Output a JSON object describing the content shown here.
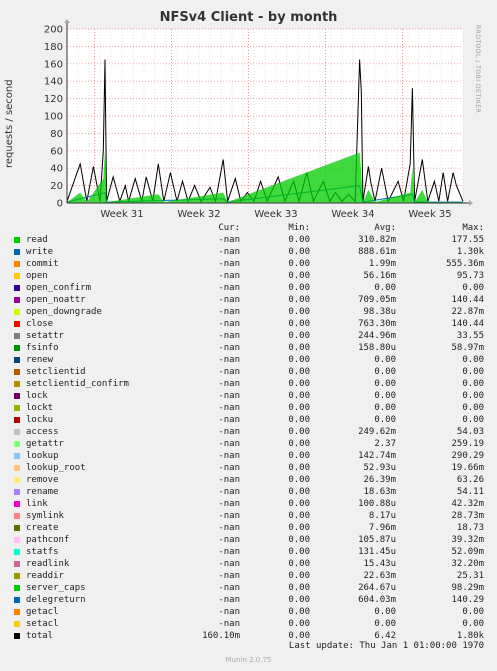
{
  "title": "NFSv4 Client - by month",
  "watermark": "RRDTOOL / TOBI OETIKER",
  "chart_data": {
    "type": "line",
    "title": "NFSv4 Client - by month",
    "ylabel": "requests / second",
    "xlabel": "",
    "ylim": [
      0,
      200
    ],
    "yticks": [
      0,
      20,
      40,
      60,
      80,
      100,
      120,
      140,
      160,
      180,
      200
    ],
    "xlim": [
      0,
      36
    ],
    "x_ticks": [
      {
        "label": "Week 31",
        "x": 5
      },
      {
        "label": "Week 32",
        "x": 12
      },
      {
        "label": "Week 33",
        "x": 19
      },
      {
        "label": "Week 34",
        "x": 26
      },
      {
        "label": "Week 35",
        "x": 33
      }
    ],
    "grid": true,
    "series": [
      {
        "name": "total",
        "color": "#000000",
        "points": [
          [
            0,
            2
          ],
          [
            1.2,
            45
          ],
          [
            1.8,
            2
          ],
          [
            2.4,
            42
          ],
          [
            3.0,
            2
          ],
          [
            3.3,
            60
          ],
          [
            3.45,
            165
          ],
          [
            3.6,
            2
          ],
          [
            4.2,
            30
          ],
          [
            4.8,
            2
          ],
          [
            5.3,
            20
          ],
          [
            5.6,
            2
          ],
          [
            6.2,
            28
          ],
          [
            6.8,
            2
          ],
          [
            7.2,
            30
          ],
          [
            7.8,
            2
          ],
          [
            8.3,
            45
          ],
          [
            8.8,
            2
          ],
          [
            9.4,
            35
          ],
          [
            10.0,
            2
          ],
          [
            10.5,
            25
          ],
          [
            11.0,
            2
          ],
          [
            11.6,
            20
          ],
          [
            12.2,
            2
          ],
          [
            13.0,
            18
          ],
          [
            13.5,
            2
          ],
          [
            14.2,
            50
          ],
          [
            14.6,
            2
          ],
          [
            15.3,
            28
          ],
          [
            15.8,
            2
          ],
          [
            16.4,
            12
          ],
          [
            17.0,
            2
          ],
          [
            17.6,
            25
          ],
          [
            18.2,
            2
          ],
          [
            19.2,
            30
          ],
          [
            19.8,
            2
          ],
          [
            20.6,
            25
          ],
          [
            21.1,
            2
          ],
          [
            21.8,
            35
          ],
          [
            22.4,
            2
          ],
          [
            23.3,
            25
          ],
          [
            23.9,
            2
          ],
          [
            24.4,
            12
          ],
          [
            25.0,
            2
          ],
          [
            25.6,
            10
          ],
          [
            26.2,
            2
          ],
          [
            26.6,
            165
          ],
          [
            26.75,
            128
          ],
          [
            26.9,
            2
          ],
          [
            27.4,
            42
          ],
          [
            27.6,
            25
          ],
          [
            28.0,
            2
          ],
          [
            28.6,
            40
          ],
          [
            29.2,
            2
          ],
          [
            30.1,
            25
          ],
          [
            30.6,
            2
          ],
          [
            31.2,
            45
          ],
          [
            31.4,
            132
          ],
          [
            31.6,
            2
          ],
          [
            32.3,
            50
          ],
          [
            32.8,
            2
          ],
          [
            33.4,
            25
          ],
          [
            33.8,
            2
          ],
          [
            34.2,
            35
          ],
          [
            34.6,
            2
          ],
          [
            35.1,
            35
          ],
          [
            35.4,
            20
          ],
          [
            36.0,
            2
          ]
        ]
      },
      {
        "name": "write",
        "color": "#0066b3",
        "points": [
          [
            0,
            1
          ],
          [
            3.45,
            12
          ],
          [
            3.6,
            1
          ],
          [
            14.2,
            5
          ],
          [
            14.6,
            1
          ],
          [
            26.6,
            20
          ],
          [
            26.9,
            1
          ],
          [
            31.4,
            10
          ],
          [
            31.6,
            1
          ],
          [
            36,
            1
          ]
        ]
      },
      {
        "name": "getattr",
        "color": "#00cc00",
        "points": [
          [
            0,
            1
          ],
          [
            1.2,
            12
          ],
          [
            1.8,
            1
          ],
          [
            3.3,
            28
          ],
          [
            3.45,
            60
          ],
          [
            3.6,
            1
          ],
          [
            8.3,
            10
          ],
          [
            8.8,
            1
          ],
          [
            14.2,
            12
          ],
          [
            14.6,
            1
          ],
          [
            26.6,
            58
          ],
          [
            26.75,
            35
          ],
          [
            26.9,
            1
          ],
          [
            27.4,
            15
          ],
          [
            28.0,
            1
          ],
          [
            31.2,
            12
          ],
          [
            31.4,
            40
          ],
          [
            31.6,
            1
          ],
          [
            32.3,
            15
          ],
          [
            32.8,
            1
          ],
          [
            36,
            1
          ]
        ]
      }
    ],
    "legend_headers": [
      "Cur:",
      "Min:",
      "Avg:",
      "Max:"
    ],
    "legend": [
      {
        "name": "read",
        "color": "#00cc00",
        "cur": "-nan",
        "min": "0.00",
        "avg": "310.82m",
        "max": "177.55"
      },
      {
        "name": "write",
        "color": "#0066b3",
        "cur": "-nan",
        "min": "0.00",
        "avg": "888.61m",
        "max": "1.30k"
      },
      {
        "name": "commit",
        "color": "#ff8000",
        "cur": "-nan",
        "min": "0.00",
        "avg": "1.99m",
        "max": "555.36m"
      },
      {
        "name": "open",
        "color": "#ffcc00",
        "cur": "-nan",
        "min": "0.00",
        "avg": "56.16m",
        "max": "95.73"
      },
      {
        "name": "open_confirm",
        "color": "#330099",
        "cur": "-nan",
        "min": "0.00",
        "avg": "0.00",
        "max": "0.00"
      },
      {
        "name": "open_noattr",
        "color": "#990099",
        "cur": "-nan",
        "min": "0.00",
        "avg": "709.05m",
        "max": "140.44"
      },
      {
        "name": "open_downgrade",
        "color": "#ccff00",
        "cur": "-nan",
        "min": "0.00",
        "avg": "98.38u",
        "max": "22.87m"
      },
      {
        "name": "close",
        "color": "#ff0000",
        "cur": "-nan",
        "min": "0.00",
        "avg": "763.30m",
        "max": "140.44"
      },
      {
        "name": "setattr",
        "color": "#808080",
        "cur": "-nan",
        "min": "0.00",
        "avg": "244.96m",
        "max": "33.55"
      },
      {
        "name": "fsinfo",
        "color": "#008f00",
        "cur": "-nan",
        "min": "0.00",
        "avg": "158.80u",
        "max": "58.97m"
      },
      {
        "name": "renew",
        "color": "#00487d",
        "cur": "-nan",
        "min": "0.00",
        "avg": "0.00",
        "max": "0.00"
      },
      {
        "name": "setclientid",
        "color": "#b35a00",
        "cur": "-nan",
        "min": "0.00",
        "avg": "0.00",
        "max": "0.00"
      },
      {
        "name": "setclientid_confirm",
        "color": "#b38f00",
        "cur": "-nan",
        "min": "0.00",
        "avg": "0.00",
        "max": "0.00"
      },
      {
        "name": "lock",
        "color": "#6b006b",
        "cur": "-nan",
        "min": "0.00",
        "avg": "0.00",
        "max": "0.00"
      },
      {
        "name": "lockt",
        "color": "#8fb300",
        "cur": "-nan",
        "min": "0.00",
        "avg": "0.00",
        "max": "0.00"
      },
      {
        "name": "locku",
        "color": "#b30000",
        "cur": "-nan",
        "min": "0.00",
        "avg": "0.00",
        "max": "0.00"
      },
      {
        "name": "access",
        "color": "#bebebe",
        "cur": "-nan",
        "min": "0.00",
        "avg": "249.62m",
        "max": "54.03"
      },
      {
        "name": "getattr",
        "color": "#80ff80",
        "cur": "-nan",
        "min": "0.00",
        "avg": "2.37",
        "max": "259.19"
      },
      {
        "name": "lookup",
        "color": "#80c9ff",
        "cur": "-nan",
        "min": "0.00",
        "avg": "142.74m",
        "max": "290.29"
      },
      {
        "name": "lookup_root",
        "color": "#ffc080",
        "cur": "-nan",
        "min": "0.00",
        "avg": "52.93u",
        "max": "19.66m"
      },
      {
        "name": "remove",
        "color": "#ffe680",
        "cur": "-nan",
        "min": "0.00",
        "avg": "26.39m",
        "max": "63.26"
      },
      {
        "name": "rename",
        "color": "#aa80ff",
        "cur": "-nan",
        "min": "0.00",
        "avg": "18.63m",
        "max": "54.11"
      },
      {
        "name": "link",
        "color": "#ee00cc",
        "cur": "-nan",
        "min": "0.00",
        "avg": "100.88u",
        "max": "42.32m"
      },
      {
        "name": "symlink",
        "color": "#ff8080",
        "cur": "-nan",
        "min": "0.00",
        "avg": "8.17u",
        "max": "28.73m"
      },
      {
        "name": "create",
        "color": "#666600",
        "cur": "-nan",
        "min": "0.00",
        "avg": "7.96m",
        "max": "18.73"
      },
      {
        "name": "pathconf",
        "color": "#ffbfff",
        "cur": "-nan",
        "min": "0.00",
        "avg": "105.87u",
        "max": "39.32m"
      },
      {
        "name": "statfs",
        "color": "#00ffcc",
        "cur": "-nan",
        "min": "0.00",
        "avg": "131.45u",
        "max": "52.09m"
      },
      {
        "name": "readlink",
        "color": "#cc6699",
        "cur": "-nan",
        "min": "0.00",
        "avg": "15.43u",
        "max": "32.20m"
      },
      {
        "name": "readdir",
        "color": "#999900",
        "cur": "-nan",
        "min": "0.00",
        "avg": "22.63m",
        "max": "25.31"
      },
      {
        "name": "server_caps",
        "color": "#00cc00",
        "cur": "-nan",
        "min": "0.00",
        "avg": "264.67u",
        "max": "98.29m"
      },
      {
        "name": "delegreturn",
        "color": "#0066b3",
        "cur": "-nan",
        "min": "0.00",
        "avg": "604.03m",
        "max": "140.29"
      },
      {
        "name": "getacl",
        "color": "#ff8000",
        "cur": "-nan",
        "min": "0.00",
        "avg": "0.00",
        "max": "0.00"
      },
      {
        "name": "setacl",
        "color": "#ffcc00",
        "cur": "-nan",
        "min": "0.00",
        "avg": "0.00",
        "max": "0.00"
      },
      {
        "name": "total",
        "color": "#000000",
        "cur": "160.10m",
        "min": "0.00",
        "avg": "6.42",
        "max": "1.80k"
      }
    ]
  },
  "last_update": "Last update: Thu Jan  1 01:00:00 1970",
  "footer": "Munin 2.0.75"
}
